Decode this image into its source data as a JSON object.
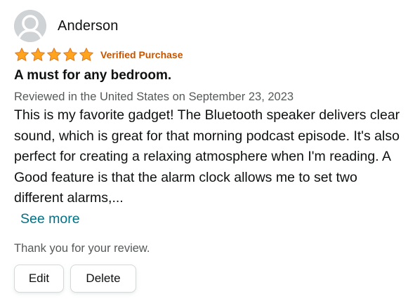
{
  "reviewer": {
    "name": "Anderson",
    "avatar_icon": "user-avatar-icon"
  },
  "rating": {
    "stars": 5,
    "max_stars": 5,
    "star_color": "#ffa41c",
    "verified_label": "Verified Purchase",
    "verified_color": "#c45500"
  },
  "review": {
    "title": "A must for any bedroom.",
    "date_line": "Reviewed in the United States on September 23, 2023",
    "body": "This is my favorite gadget! The Bluetooth speaker delivers clear sound, which is great for that morning podcast episode. It's also perfect for creating a relaxing atmosphere when I'm reading. A Good feature is that the alarm clock allows me to set two different alarms,...",
    "see_more_label": "See more",
    "link_color": "#007185"
  },
  "footer": {
    "thanks_text": "Thank you for your review.",
    "edit_label": "Edit",
    "delete_label": "Delete"
  }
}
